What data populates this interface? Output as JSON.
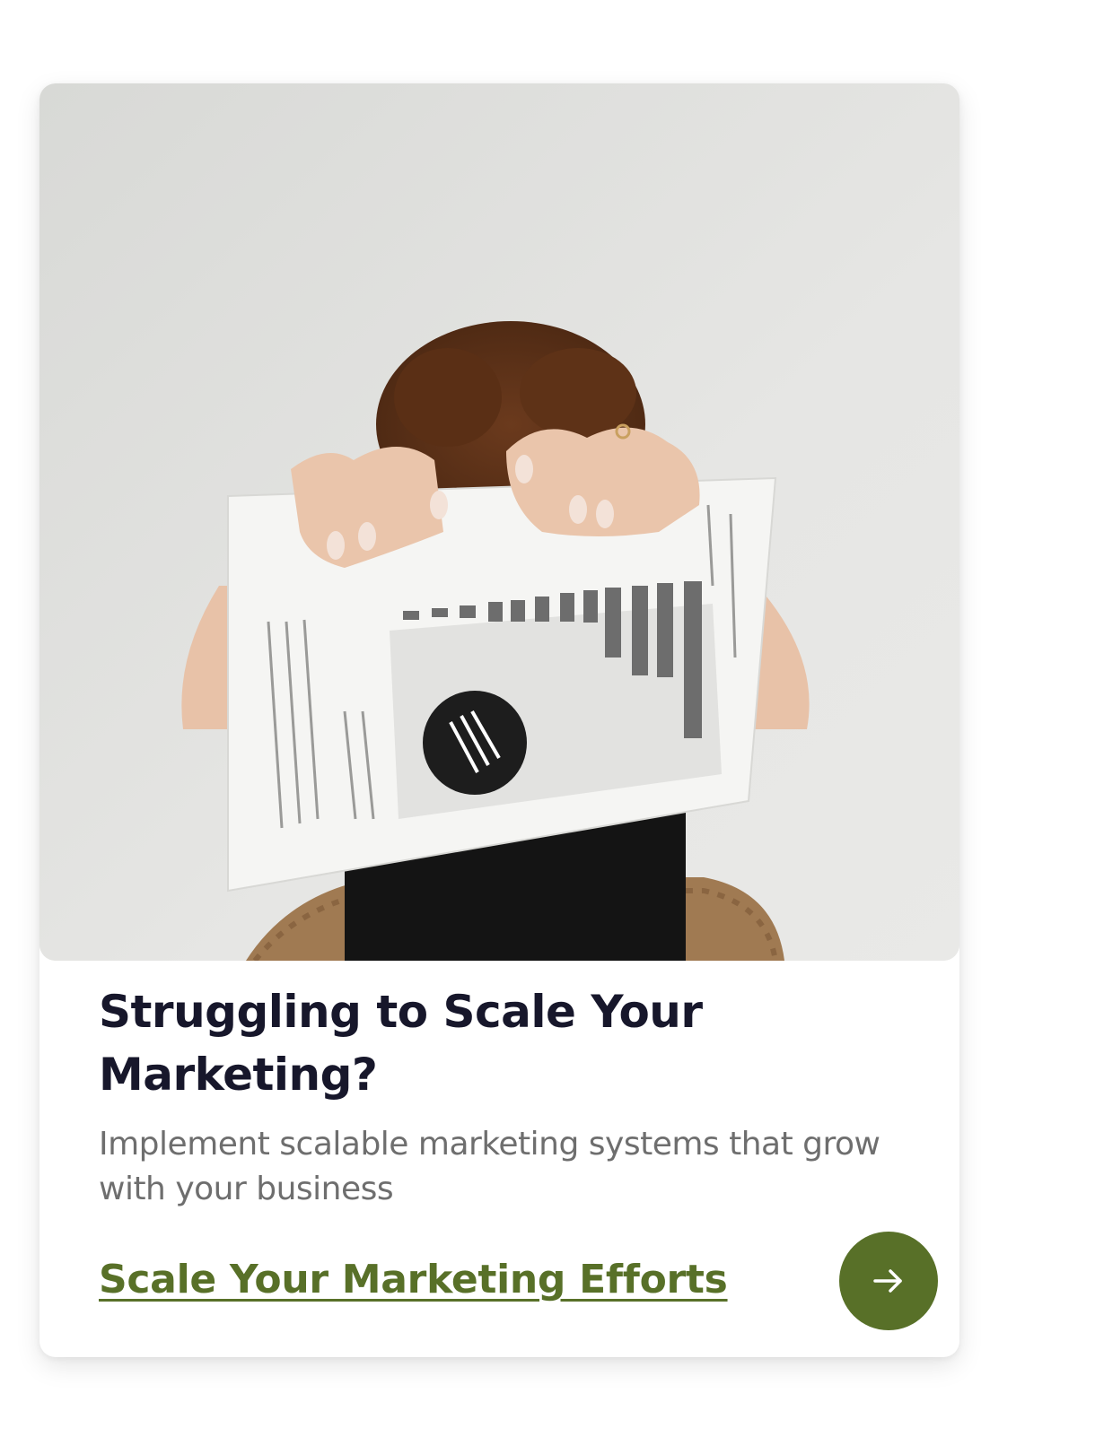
{
  "card": {
    "image_alt": "",
    "title": "Struggling to Scale Your Marketing?",
    "description": "Implement scalable marketing systems that grow with your business",
    "cta_label": "Scale Your Marketing Efforts",
    "cta_button_icon": "arrow-right-icon"
  },
  "colors": {
    "accent": "#587028",
    "title": "#17172b",
    "description": "#6e6e6e",
    "background": "#ffffff"
  }
}
